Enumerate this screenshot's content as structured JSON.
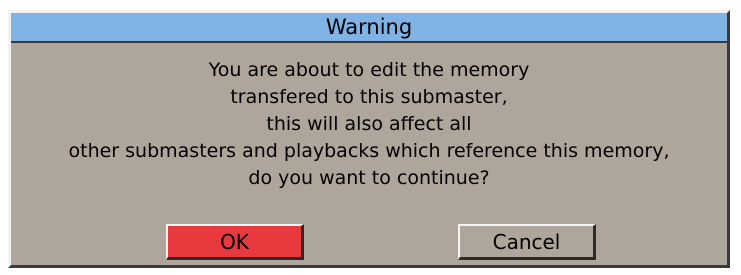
{
  "dialog": {
    "title": "Warning",
    "message_lines": [
      "You are about to edit the memory",
      "transfered to this submaster,",
      "this will also affect all",
      "other submasters and playbacks which reference this memory,",
      "do you want to continue?"
    ],
    "ok_label": "OK",
    "cancel_label": "Cancel"
  },
  "colors": {
    "titlebar": "#7fb3e6",
    "body": "#aea59b",
    "ok_button": "#e8393f"
  }
}
